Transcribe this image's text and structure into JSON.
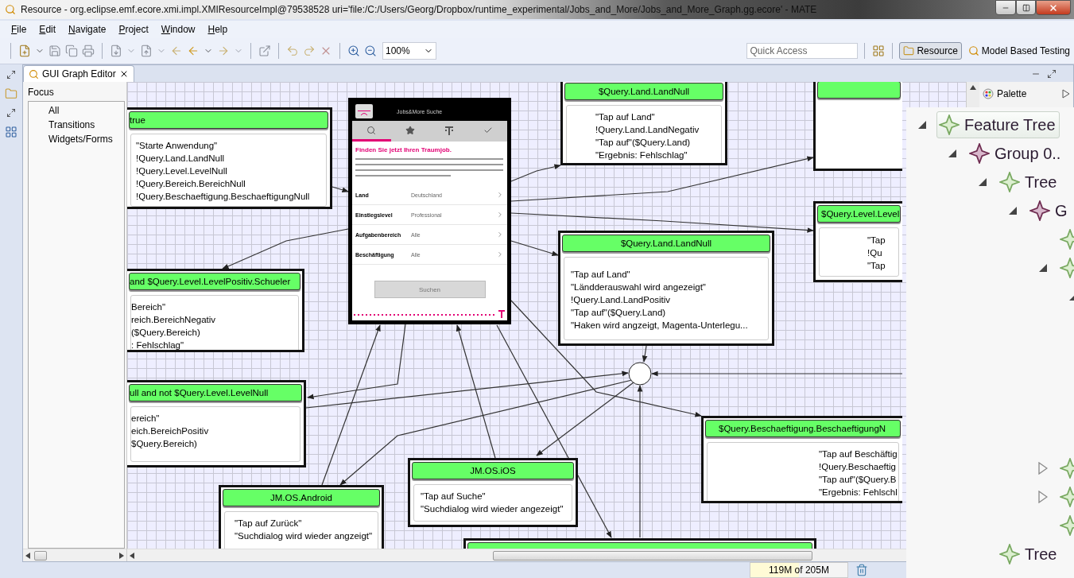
{
  "window": {
    "title": "Resource - org.eclipse.emf.ecore.xmi.impl.XMIResourceImpl@79538528 uri='file:/C:/Users/Georg/Dropbox/runtime_experimental/Jobs_and_More/Jobs_and_More_Graph.gg.ecore' - MATE"
  },
  "menu": [
    "File",
    "Edit",
    "Navigate",
    "Project",
    "Window",
    "Help"
  ],
  "toolbar": {
    "zoom": "100%",
    "quick_access": {
      "placeholder": "Quick Access"
    },
    "perspectives": [
      {
        "label": "Resource",
        "selected": true
      },
      {
        "label": "Model Based Testing",
        "selected": false
      }
    ]
  },
  "editor": {
    "tab": "GUI Graph Editor",
    "focus": {
      "title": "Focus",
      "items": [
        "All",
        "Transitions",
        "Widgets/Forms"
      ]
    },
    "nodes": [
      {
        "header": "true",
        "lines": [
          "\"Starte Anwendung\"",
          "!Query.Land.LandNull",
          "!Query.Level.LevelNull",
          "!Query.Bereich.BereichNull",
          "!Query.Beschaeftigung.BeschaeftigungNull"
        ]
      },
      {
        "header": "$Query.Land.LandNull",
        "lines": [
          "\"Tap auf Land\"",
          "!Query.Land.LandNegativ",
          "\"Tap auf\"($Query.Land)",
          "\"Ergebnis: Fehlschlag\""
        ]
      },
      {
        "kind": "state"
      },
      {
        "header": "$Query.Level.Level",
        "lines": [
          "\"Tap",
          "!Qu",
          "\"Tap"
        ]
      },
      {
        "header": "$Query.Land.LandNull",
        "lines": [
          "\"Tap auf Land\"",
          "\"Ländderauswahl wird angezeigt\"",
          "!Query.Land.LandPositiv",
          "\"Tap auf\"($Query.Land)",
          "\"Haken wird angzeigt, Magenta-Unterlegu..."
        ]
      },
      {
        "header": "and $Query.Level.LevelPositiv.Schueler",
        "lines": [
          "Bereich\"",
          "reich.BereichNegativ",
          "($Query.Bereich)",
          ": Fehlschlag\""
        ]
      },
      {
        "header": "ull and not $Query.Level.LevelNull",
        "lines": [
          "ereich\"",
          "eich.BereichPositiv",
          "$Query.Bereich)"
        ]
      },
      {
        "header": "JM.OS.Android",
        "lines": [
          "\"Tap auf Zurück\"",
          "\"Suchdialog wird wieder angzeigt\""
        ]
      },
      {
        "header": "JM.OS.iOS",
        "lines": [
          "\"Tap auf Suche\"",
          "\"Suchdialog wird wieder angezeigt\""
        ]
      },
      {
        "header": "$Query.Beschaeftigung.BeschaeftigungN",
        "lines": [
          "\"Tap auf Beschäftig",
          "!Query.Beschaeftig",
          "\"Tap auf\"($Query.B",
          "\"Ergebnis: Fehlschl"
        ]
      },
      {
        "kind": "state"
      }
    ],
    "screen_preview": {
      "title": "Jobs&More Suche",
      "tabs": [
        {
          "selected": true
        },
        {
          "selected": false
        },
        {
          "selected": false
        },
        {
          "selected": false
        }
      ],
      "headline": "Finden Sie jetzt Ihren Traumjob.",
      "rows": [
        {
          "label": "Land",
          "value": "Deutschland"
        },
        {
          "label": "Einstiegslevel",
          "value": "Professional"
        },
        {
          "label": "Aufgabenbereich",
          "value": "Alle"
        },
        {
          "label": "Beschäftigung",
          "value": "Alle"
        }
      ],
      "button": "Suchen"
    },
    "palette": {
      "title": "Palette"
    }
  },
  "feature_tree": [
    {
      "label": "Feature Tree",
      "kind": "feature",
      "expanded": true,
      "selected": true,
      "children": [
        {
          "label": "Group 0..",
          "kind": "group",
          "expanded": true,
          "selected": false,
          "children": [
            {
              "label": "Tree",
              "kind": "feature",
              "expanded": true,
              "selected": false,
              "children": [
                {
                  "label": "G",
                  "kind": "group",
                  "expanded": true,
                  "selected": false,
                  "children": [
                    {
                      "kind": "feature",
                      "selected": false
                    },
                    {
                      "kind": "feature",
                      "expanded": true,
                      "selected": false,
                      "children": [
                        {
                          "expanded": true
                        }
                      ]
                    },
                    {
                      "kind": "feature",
                      "expanded": false,
                      "selected": false
                    },
                    {
                      "kind": "feature",
                      "expanded": false,
                      "selected": false
                    },
                    {
                      "kind": "feature",
                      "selected": false
                    }
                  ]
                }
              ]
            },
            {
              "label": "Tree",
              "kind": "feature",
              "selected": false
            }
          ]
        }
      ]
    }
  ],
  "status_bar": {
    "memory": "119M of 205M"
  }
}
